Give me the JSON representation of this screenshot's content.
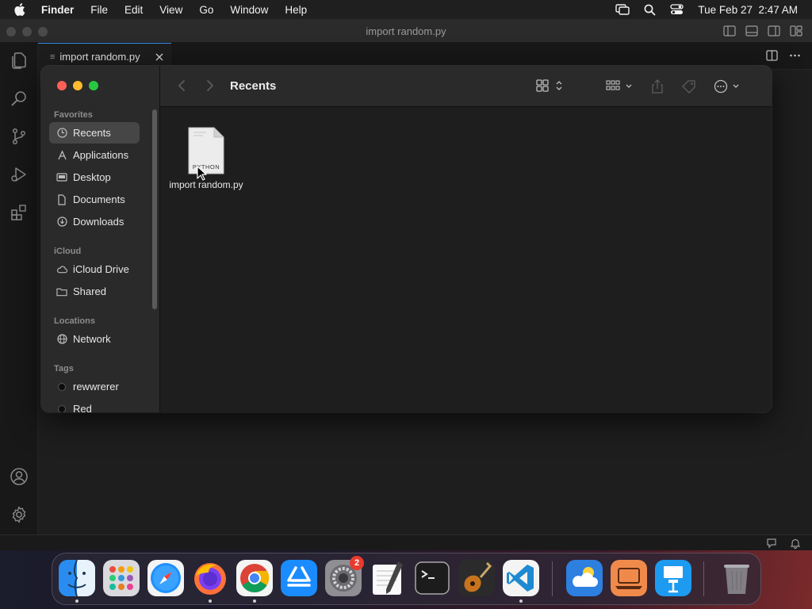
{
  "menubar": {
    "app_name": "Finder",
    "menus": [
      "File",
      "Edit",
      "View",
      "Go",
      "Window",
      "Help"
    ],
    "datetime": "Tue Feb 27  2:47 AM"
  },
  "vscode": {
    "window_title": "import random.py",
    "tab_label": "import random.py"
  },
  "finder": {
    "location_title": "Recents",
    "sidebar": {
      "favorites_header": "Favorites",
      "favorites": [
        "Recents",
        "Applications",
        "Desktop",
        "Documents",
        "Downloads"
      ],
      "icloud_header": "iCloud",
      "icloud": [
        "iCloud Drive",
        "Shared"
      ],
      "locations_header": "Locations",
      "locations": [
        "Network"
      ],
      "tags_header": "Tags",
      "tags": [
        "rewwrerer",
        "Red"
      ]
    },
    "files": [
      {
        "name": "import random.py",
        "type_label": "PYTHON"
      }
    ]
  },
  "dock": {
    "apps": [
      "Finder",
      "Launchpad",
      "Safari",
      "Firefox",
      "Google Chrome",
      "App Store",
      "System Settings",
      "TextEdit",
      "Terminal",
      "GarageBand",
      "Visual Studio Code",
      "Weather",
      "Screen Sharing",
      "Keynote",
      "Trash"
    ],
    "system_settings_badge": "2"
  },
  "colors": {
    "accent": "#3b8eea",
    "close_light": "#ff5f57",
    "minimize_light": "#febc2e",
    "zoom_light": "#28c840",
    "badge": "#e93a2f"
  }
}
